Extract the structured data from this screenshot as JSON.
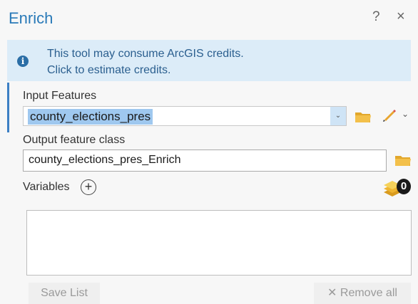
{
  "title": "Enrich",
  "title_bar": {
    "help_label": "?",
    "close_label": "×"
  },
  "banner": {
    "info_icon": "info-icon",
    "line1": "This tool may consume ArcGIS credits.",
    "line2": "Click to estimate credits."
  },
  "input_features": {
    "label": "Input Features",
    "value": "county_elections_pres",
    "dropdown_glyph": "⌄",
    "pencil_dropdown_glyph": "⌄"
  },
  "output_feature_class": {
    "label": "Output feature class",
    "value": "county_elections_pres_Enrich"
  },
  "variables": {
    "label": "Variables",
    "add_glyph": "+",
    "count": "0"
  },
  "footer": {
    "save_list_label": "Save List",
    "remove_all_label": "✕ Remove all"
  },
  "colors": {
    "title": "#2a7ab8",
    "banner_bg": "#dcecf8",
    "selection": "#9fc8ef",
    "folder": "#f3c04a"
  }
}
